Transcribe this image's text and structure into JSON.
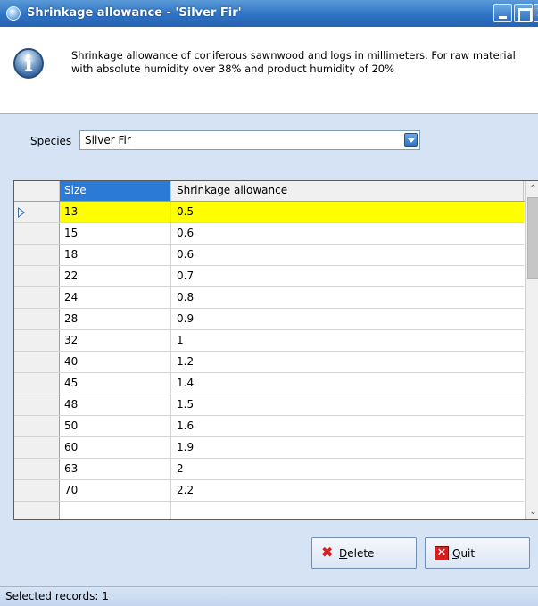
{
  "window": {
    "title": "Shrinkage allowance - 'Silver Fir'"
  },
  "info": {
    "text": "Shrinkage allowance of coniferous sawnwood and logs in millimeters. For raw material with absolute humidity over 38% and product humidity of 20%"
  },
  "species": {
    "label": "Species",
    "value": "Silver Fir"
  },
  "grid": {
    "columns": [
      "Size",
      "Shrinkage allowance"
    ],
    "rows": [
      {
        "size": "13",
        "shrinkage": "0.5",
        "selected": true
      },
      {
        "size": "15",
        "shrinkage": "0.6"
      },
      {
        "size": "18",
        "shrinkage": "0.6"
      },
      {
        "size": "22",
        "shrinkage": "0.7"
      },
      {
        "size": "24",
        "shrinkage": "0.8"
      },
      {
        "size": "28",
        "shrinkage": "0.9"
      },
      {
        "size": "32",
        "shrinkage": "1"
      },
      {
        "size": "40",
        "shrinkage": "1.2"
      },
      {
        "size": "45",
        "shrinkage": "1.4"
      },
      {
        "size": "48",
        "shrinkage": "1.5"
      },
      {
        "size": "50",
        "shrinkage": "1.6"
      },
      {
        "size": "60",
        "shrinkage": "1.9"
      },
      {
        "size": "63",
        "shrinkage": "2"
      },
      {
        "size": "70",
        "shrinkage": "2.2"
      },
      {
        "size": "",
        "shrinkage": ""
      }
    ]
  },
  "buttons": {
    "delete": {
      "label_first": "D",
      "label_rest": "elete"
    },
    "quit": {
      "label_first": "Q",
      "label_rest": "uit"
    }
  },
  "status": {
    "text": "Selected records: 1"
  },
  "colors": {
    "title_bar": "#2f73c4",
    "selected_row": "#ffff00",
    "sorted_header": "#2a7ad6"
  }
}
